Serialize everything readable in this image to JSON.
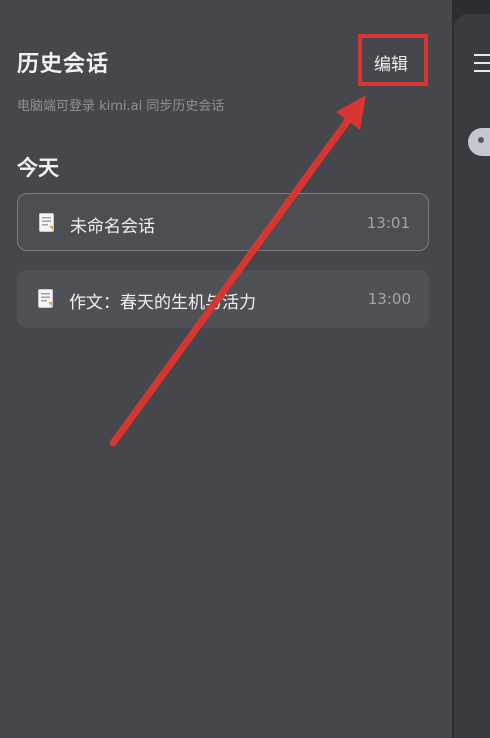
{
  "header": {
    "title": "历史会话",
    "edit_label": "编辑",
    "subtitle": "电脑端可登录 kimi.ai  同步历史会话"
  },
  "section": {
    "label": "今天"
  },
  "conversations": [
    {
      "title": "未命名会话",
      "time": "13:01",
      "icon": "document-icon"
    },
    {
      "title": "作文：春天的生机与活力",
      "time": "13:00",
      "icon": "document-icon"
    }
  ],
  "colors": {
    "highlight": "#d6362f",
    "background": "#46474c"
  },
  "icons": {
    "menu": "menu-icon"
  }
}
